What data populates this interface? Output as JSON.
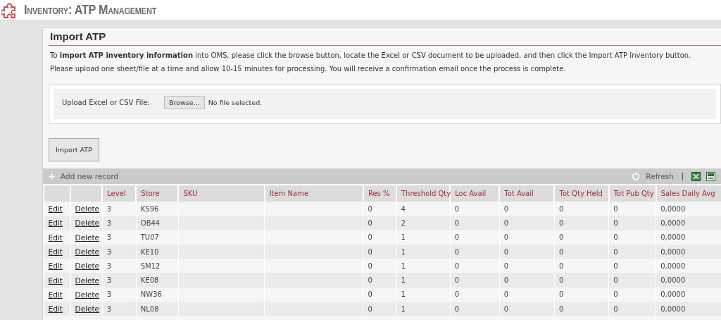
{
  "header": {
    "title": "Inventory: ATP Management"
  },
  "import_panel": {
    "title": "Import ATP",
    "instructions": [
      "To **import ATP inventory information** into OMS, please click the browse button, locate the Excel or CSV document to be uploaded, and then click the Import ATP Inventory button.",
      "Please upload one sheet/file at a time and allow 10-15 minutes for processing. You will receive a confirmation email once the process is complete."
    ],
    "upload": {
      "label": "Upload Excel or CSV File:",
      "browse_button": "Browse...",
      "file_status": "No file selected."
    },
    "submit_button": "Import ATP"
  },
  "grid": {
    "toolbar": {
      "add": "Add new record",
      "refresh": "Refresh"
    },
    "columns": [
      "",
      "",
      "Level",
      "Store",
      "SKU",
      "Item Name",
      "Res %",
      "Threshold Qty",
      "Loc Avail",
      "Tot Avail",
      "Tot Qty Held",
      "Tot Pub Qty",
      "Sales Daily Avg"
    ],
    "rows": [
      {
        "cells": [
          "Edit",
          "Delete",
          "3",
          "KS96",
          "",
          "",
          "0",
          "4",
          "0",
          "0",
          "0",
          "0",
          "0,0000"
        ]
      },
      {
        "cells": [
          "Edit",
          "Delete",
          "3",
          "OB44",
          "",
          "",
          "0",
          "2",
          "0",
          "0",
          "0",
          "0",
          "0,0000"
        ]
      },
      {
        "cells": [
          "Edit",
          "Delete",
          "3",
          "TU07",
          "",
          "",
          "0",
          "1",
          "0",
          "0",
          "0",
          "0",
          "0,0000"
        ]
      },
      {
        "cells": [
          "Edit",
          "Delete",
          "3",
          "KE10",
          "",
          "",
          "0",
          "1",
          "0",
          "0",
          "0",
          "0",
          "0,0000"
        ]
      },
      {
        "cells": [
          "Edit",
          "Delete",
          "3",
          "SM12",
          "",
          "",
          "0",
          "1",
          "0",
          "0",
          "0",
          "0",
          "0,0000"
        ]
      },
      {
        "cells": [
          "Edit",
          "Delete",
          "3",
          "KE08",
          "",
          "",
          "0",
          "1",
          "0",
          "0",
          "0",
          "0",
          "0,0000"
        ]
      },
      {
        "cells": [
          "Edit",
          "Delete",
          "3",
          "NW36",
          "",
          "",
          "0",
          "1",
          "0",
          "0",
          "0",
          "0",
          "0,0000"
        ]
      },
      {
        "cells": [
          "Edit",
          "Delete",
          "3",
          "NL08",
          "",
          "",
          "0",
          "1",
          "0",
          "0",
          "0",
          "0",
          "0,0000"
        ]
      }
    ]
  }
}
